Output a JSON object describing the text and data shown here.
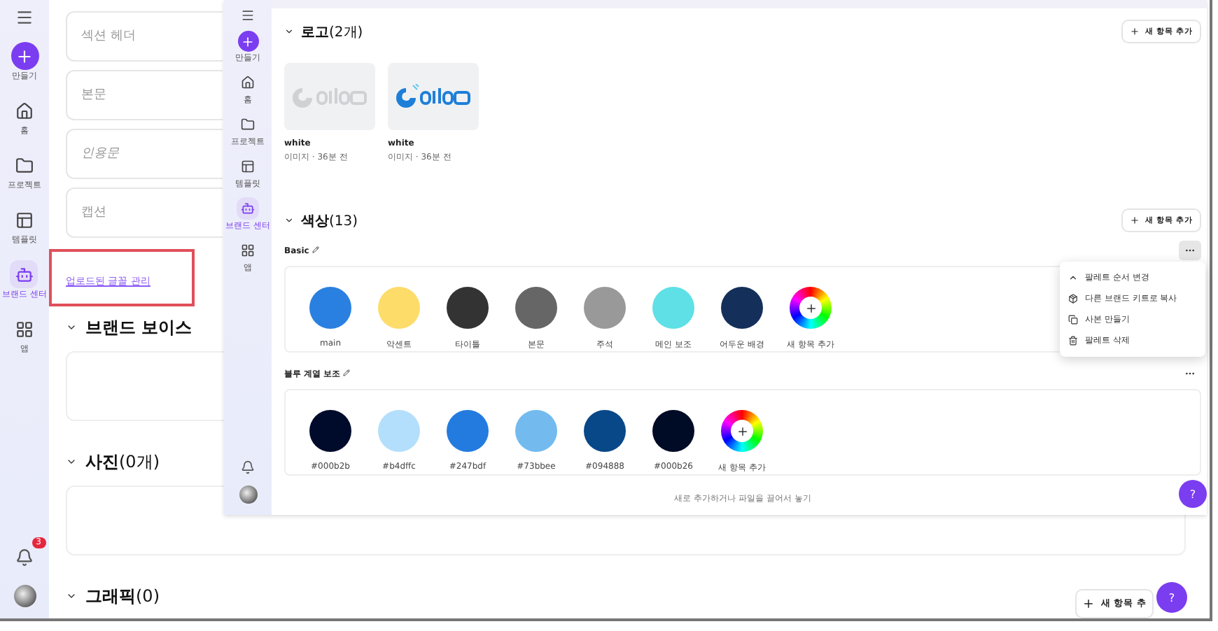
{
  "back_window": {
    "sidebar": {
      "items": [
        {
          "kind": "create",
          "label": "만들기",
          "selected": false
        },
        {
          "kind": "home",
          "label": "홈",
          "selected": false
        },
        {
          "kind": "folder",
          "label": "프로젝트",
          "selected": false
        },
        {
          "kind": "template",
          "label": "템플릿",
          "selected": false
        },
        {
          "kind": "brand",
          "label": "브랜드 센터",
          "selected": true
        },
        {
          "kind": "apps",
          "label": "앱",
          "selected": false
        }
      ],
      "notification_badge": "3"
    },
    "font_fields": [
      {
        "kind": "text",
        "placeholder": "섹션 헤더"
      },
      {
        "kind": "text",
        "placeholder": "본문"
      },
      {
        "kind": "quote",
        "placeholder": "인용문"
      },
      {
        "kind": "text",
        "placeholder": "캡션"
      }
    ],
    "font_link": {
      "label": "업로드된 글꼴 관리",
      "highlighted": true
    },
    "sections": [
      {
        "title": "브랜드 보이스"
      },
      {
        "title": "사진",
        "count": "(0개)"
      },
      {
        "title": "그래픽",
        "count": "(0)"
      }
    ],
    "add_button": "새 항목 추",
    "help_button": "?"
  },
  "front_window": {
    "sidebar": {
      "items": [
        {
          "kind": "create",
          "label": "만들기",
          "selected": false
        },
        {
          "kind": "home",
          "label": "홈",
          "selected": false
        },
        {
          "kind": "folder",
          "label": "프로젝트",
          "selected": false
        },
        {
          "kind": "template",
          "label": "템플릿",
          "selected": false
        },
        {
          "kind": "brand",
          "label": "브랜드 센터",
          "selected": true
        },
        {
          "kind": "apps",
          "label": "앱",
          "selected": false
        }
      ]
    },
    "logos": {
      "title": "로고",
      "count": "(2개)",
      "add_button": "새 항목 추가",
      "items": [
        {
          "kind": "faded",
          "name": "white",
          "meta": "이미지 · 36분 전"
        },
        {
          "kind": "color",
          "name": "white",
          "meta": "이미지 · 36분 전"
        }
      ]
    },
    "colors": {
      "title": "색상",
      "count": "(13)",
      "add_button": "새 항목 추가",
      "palettes": [
        {
          "name": "Basic",
          "menu_open": true,
          "swatches": [
            {
              "label": "main",
              "color": "#2a80e0"
            },
            {
              "label": "악센트",
              "color": "#fddc6a"
            },
            {
              "label": "타이틀",
              "color": "#333333"
            },
            {
              "label": "본문",
              "color": "#666666"
            },
            {
              "label": "주석",
              "color": "#999999"
            },
            {
              "label": "메인 보조",
              "color": "#5ee0e6"
            },
            {
              "label": "어두운 배경",
              "color": "#14305a"
            }
          ],
          "add_label": "새 항목 추가"
        },
        {
          "name": "블루 계열 보조",
          "menu_open": false,
          "swatches": [
            {
              "label": "#000b2b",
              "color": "#000b2b"
            },
            {
              "label": "#b4dffc",
              "color": "#b4dffc"
            },
            {
              "label": "#247bdf",
              "color": "#247bdf"
            },
            {
              "label": "#73bbee",
              "color": "#73bbee"
            },
            {
              "label": "#094888",
              "color": "#094888"
            },
            {
              "label": "#000b26",
              "color": "#000b26"
            }
          ],
          "add_label": "새 항목 추가"
        }
      ],
      "menu": [
        {
          "kind": "reorder",
          "label": "팔레트 순서 변경"
        },
        {
          "kind": "copy_kit",
          "label": "다른 브랜드 키트로 복사"
        },
        {
          "kind": "duplicate",
          "label": "사본 만들기"
        },
        {
          "kind": "delete",
          "label": "팔레트 삭제"
        }
      ]
    },
    "drop_hint": "새로 추가하거나 파일을 끌어서 놓기",
    "help_button": "?"
  }
}
